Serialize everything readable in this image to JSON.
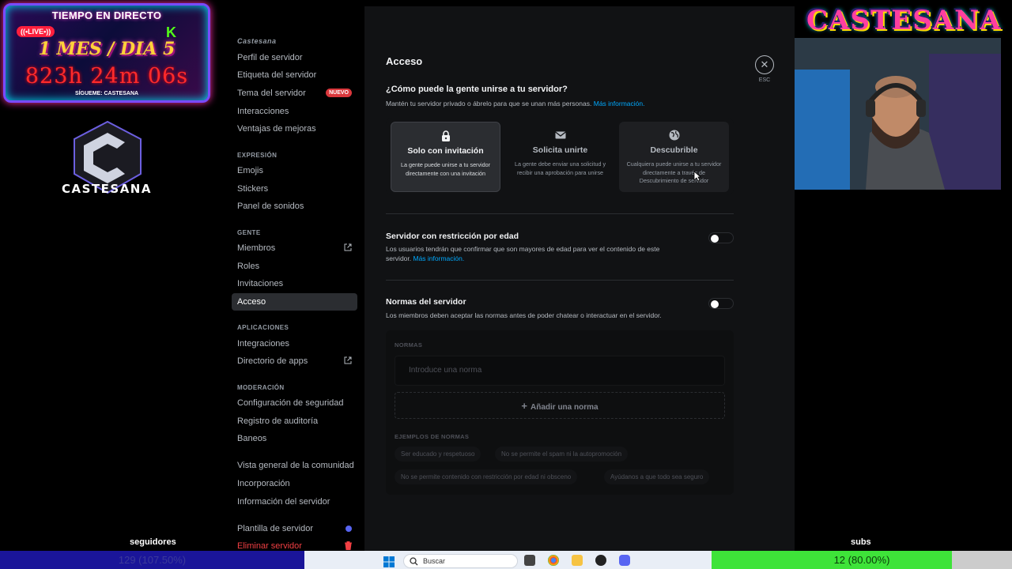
{
  "overlay": {
    "timer_title": "TIEMPO EN DIRECTO",
    "live_badge": "((•LIVE•))",
    "month_day": "1 MES / DIA 5",
    "countdown": "823h 24m 06s",
    "follow_text": "SÍGUEME: CASTESANA",
    "brand_name": "CASTESANA",
    "cam_title": "CASTESANA",
    "followers_label": "seguidores",
    "followers_value": "129 (107.50%)",
    "followers_progress": 1.0,
    "subs_label": "subs",
    "subs_value": "12 (80.00%)",
    "subs_progress": 0.8
  },
  "sidebar": {
    "server_name": "Castesana",
    "items": [
      {
        "label": "Perfil de servidor"
      },
      {
        "label": "Etiqueta del servidor"
      },
      {
        "label": "Tema del servidor",
        "badge": "NUEVO"
      },
      {
        "label": "Interacciones"
      },
      {
        "label": "Ventajas de mejoras"
      }
    ],
    "section_expresion": "EXPRESIÓN",
    "expresion_items": [
      {
        "label": "Emojis"
      },
      {
        "label": "Stickers"
      },
      {
        "label": "Panel de sonidos"
      }
    ],
    "section_gente": "GENTE",
    "gente_items": [
      {
        "label": "Miembros"
      },
      {
        "label": "Roles"
      },
      {
        "label": "Invitaciones"
      },
      {
        "label": "Acceso"
      }
    ],
    "section_apps": "APLICACIONES",
    "apps_items": [
      {
        "label": "Integraciones"
      },
      {
        "label": "Directorio de apps"
      }
    ],
    "section_moderacion": "MODERACIÓN",
    "moderacion_items": [
      {
        "label": "Configuración de seguridad"
      },
      {
        "label": "Registro de auditoría"
      },
      {
        "label": "Baneos"
      }
    ],
    "community_items": [
      {
        "label": "Vista general de la comunidad"
      },
      {
        "label": "Incorporación"
      },
      {
        "label": "Información del servidor"
      }
    ],
    "template_label": "Plantilla de servidor",
    "delete_label": "Eliminar servidor"
  },
  "main": {
    "title": "Acceso",
    "close_label": "ESC",
    "question": "¿Cómo puede la gente unirse a tu servidor?",
    "question_desc": "Mantén tu servidor privado o ábrelo para que se unan más personas.",
    "more_info": "Más información.",
    "options": [
      {
        "title": "Solo con invitación",
        "desc": "La gente puede unirse a tu servidor directamente con una invitación",
        "selected": true
      },
      {
        "title": "Solicita unirte",
        "desc": "La gente debe enviar una solicitud y recibir una aprobación para unirse",
        "selected": false
      },
      {
        "title": "Descubrible",
        "desc": "Cualquiera puede unirse a tu servidor directamente a través de Descubrimiento de servidor",
        "selected": false
      }
    ],
    "age_title": "Servidor con restricción por edad",
    "age_desc": "Los usuarios tendrán que confirmar que son mayores de edad para ver el contenido de este servidor.",
    "age_link": "Más información.",
    "age_enabled": false,
    "rules_title": "Normas del servidor",
    "rules_desc": "Los miembros deben aceptar las normas antes de poder chatear o interactuar en el servidor.",
    "rules_enabled": false,
    "rules_label": "NORMAS",
    "rule_placeholder": "Introduce una norma",
    "add_rule": "Añadir una norma",
    "examples_label": "EJEMPLOS DE NORMAS",
    "examples": [
      "Ser educado y respetuoso",
      "No se permite el spam ni la autopromoción",
      "No se permite contenido con restricción por edad ni obsceno",
      "Ayúdanos a que todo sea seguro"
    ]
  },
  "taskbar": {
    "search_placeholder": "Buscar"
  },
  "colors": {
    "accent": "#5865f2",
    "link": "#00a8fc",
    "danger": "#f23f43",
    "subs_bar": "#3ee339",
    "followers_bar": "#1a1599"
  }
}
